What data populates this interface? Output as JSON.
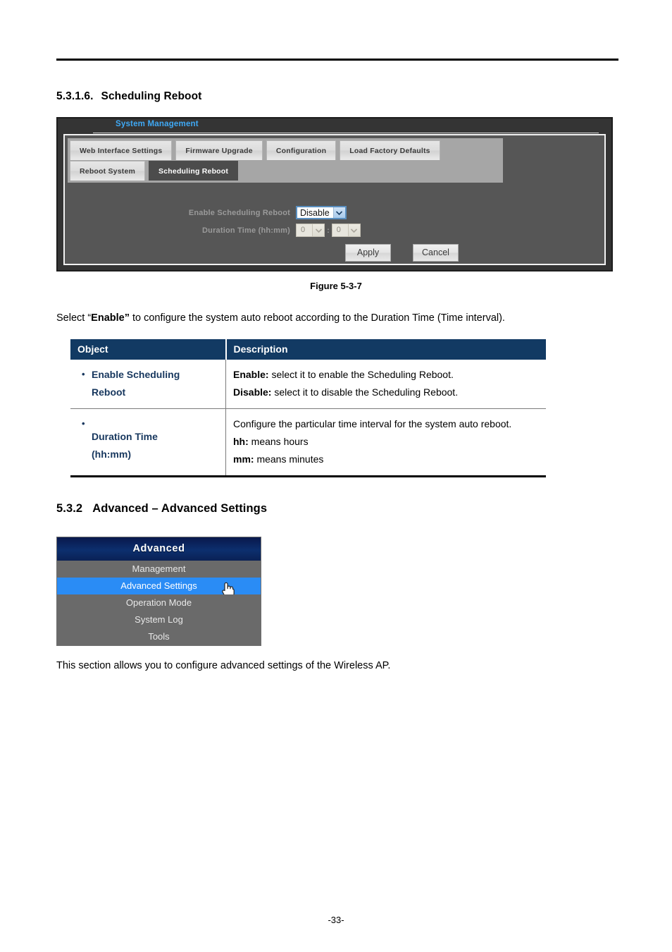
{
  "document": {
    "page_number": "-33-",
    "section_6": {
      "number": "5.3.1.6.",
      "title": "Scheduling Reboot"
    },
    "section_2": {
      "number": "5.3.2",
      "title": "Advanced – Advanced Settings"
    },
    "figure_caption": "Figure 5-3-7",
    "paragraph_select": "Select “Enable” to configure the system auto reboot according to the Duration Time (Time interval).",
    "paragraph_select_bold": "Enable”",
    "paragraph_advanced": "This section allows you to configure advanced settings of the Wireless AP."
  },
  "screenshot": {
    "title": "System Management",
    "tabs_row1": [
      {
        "label": "Web Interface Settings",
        "active": false
      },
      {
        "label": "Firmware Upgrade",
        "active": false
      },
      {
        "label": "Configuration",
        "active": false
      },
      {
        "label": "Load Factory Defaults",
        "active": false
      }
    ],
    "tabs_row2": [
      {
        "label": "Reboot System",
        "active": false
      },
      {
        "label": "Scheduling Reboot",
        "active": true
      }
    ],
    "form": {
      "enable_label": "Enable Scheduling Reboot",
      "enable_value": "Disable",
      "duration_label": "Duration Time (hh:mm)",
      "duration_hours": "0",
      "duration_minutes": "0",
      "duration_separator": ":",
      "apply_label": "Apply",
      "cancel_label": "Cancel"
    }
  },
  "desc_table": {
    "headers": {
      "object": "Object",
      "description": "Description"
    },
    "rows": [
      {
        "object_line1": "Enable Scheduling",
        "object_line2": "Reboot",
        "desc": [
          {
            "bold": "Enable:",
            "text": " select it to enable the Scheduling Reboot."
          },
          {
            "bold": "Disable:",
            "text": " select it to disable the Scheduling Reboot."
          }
        ]
      },
      {
        "object_line1": "Duration Time",
        "object_line2": "(hh:mm)",
        "desc": [
          {
            "bold": "",
            "text": "Configure the particular time interval for the system auto reboot."
          },
          {
            "bold": "hh:",
            "text": " means hours"
          },
          {
            "bold": "mm:",
            "text": " means minutes"
          }
        ]
      }
    ]
  },
  "advanced_menu": {
    "header": "Advanced",
    "items": [
      {
        "label": "Management",
        "selected": false
      },
      {
        "label": "Advanced Settings",
        "selected": true
      },
      {
        "label": "Operation Mode",
        "selected": false
      },
      {
        "label": "System Log",
        "selected": false
      },
      {
        "label": "Tools",
        "selected": false
      }
    ]
  },
  "colors": {
    "accent_blue": "#3fa9f5",
    "table_header": "#123a63",
    "object_text": "#17375e",
    "menu_selected": "#2a8cf5",
    "menu_header_navy": "#0c2f6e",
    "panel_dark": "#343434",
    "panel_body": "#565656"
  }
}
